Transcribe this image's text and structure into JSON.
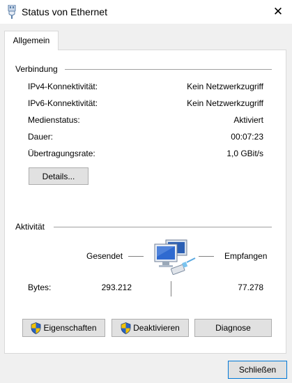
{
  "window": {
    "title": "Status von Ethernet",
    "close_glyph": "✕"
  },
  "tabs": [
    {
      "label": "Allgemein"
    }
  ],
  "connection": {
    "heading": "Verbindung",
    "rows": [
      {
        "label": "IPv4-Konnektivität:",
        "value": "Kein Netzwerkzugriff"
      },
      {
        "label": "IPv6-Konnektivität:",
        "value": "Kein Netzwerkzugriff"
      },
      {
        "label": "Medienstatus:",
        "value": "Aktiviert"
      },
      {
        "label": "Dauer:",
        "value": "00:07:23"
      },
      {
        "label": "Übertragungsrate:",
        "value": "1,0 GBit/s"
      }
    ],
    "details_button": "Details..."
  },
  "activity": {
    "heading": "Aktivität",
    "sent_label": "Gesendet",
    "received_label": "Empfangen",
    "bytes_label": "Bytes:",
    "bytes_sent": "293.212",
    "bytes_received": "77.278"
  },
  "buttons": {
    "properties": "Eigenschaften",
    "disable": "Deaktivieren",
    "diagnose": "Diagnose",
    "close": "Schließen"
  },
  "colors": {
    "accent": "#0078d7",
    "monitor_blue": "#2b5fb4",
    "shield_blue": "#2a63c4",
    "shield_yellow": "#f2c200"
  },
  "icons": [
    "network-adapter-icon",
    "shield-icon",
    "network-computers-icon",
    "close-icon"
  ]
}
